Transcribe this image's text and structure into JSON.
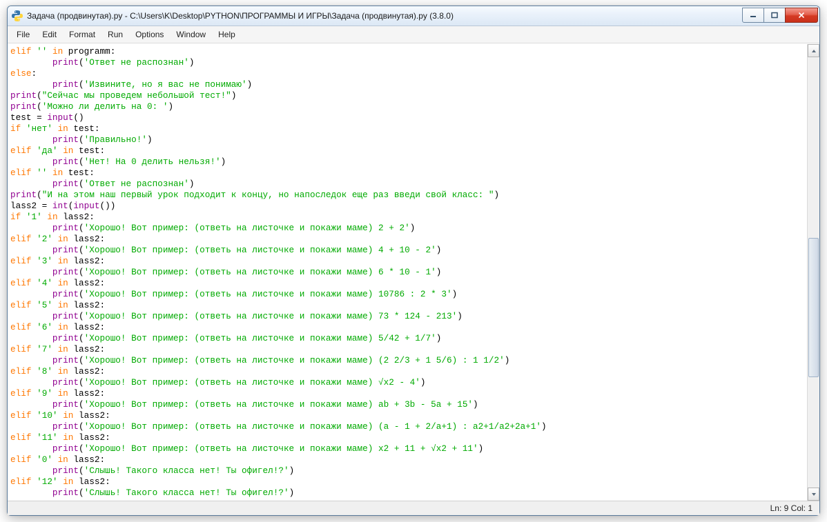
{
  "window": {
    "title": "Задача (продвинутая).py - C:\\Users\\K\\Desktop\\PYTHON\\ПРОГРАММЫ И ИГРЫ\\Задача (продвинутая).py (3.8.0)"
  },
  "menu": [
    "File",
    "Edit",
    "Format",
    "Run",
    "Options",
    "Window",
    "Help"
  ],
  "status": {
    "text": "Ln: 9  Col: 1"
  },
  "code_lines": [
    [
      [
        "kw",
        "elif"
      ],
      [
        "op",
        " "
      ],
      [
        "str",
        "''"
      ],
      [
        "op",
        " "
      ],
      [
        "kw",
        "in"
      ],
      [
        "op",
        " programm:"
      ]
    ],
    [
      [
        "op",
        "        "
      ],
      [
        "bi",
        "print"
      ],
      [
        "op",
        "("
      ],
      [
        "str",
        "'Ответ не распознан'"
      ],
      [
        "op",
        ")"
      ]
    ],
    [
      [
        "kw",
        "else"
      ],
      [
        "op",
        ":"
      ]
    ],
    [
      [
        "op",
        "        "
      ],
      [
        "bi",
        "print"
      ],
      [
        "op",
        "("
      ],
      [
        "str",
        "'Извините, но я вас не понимаю'"
      ],
      [
        "op",
        ")"
      ]
    ],
    [
      [
        "bi",
        "print"
      ],
      [
        "op",
        "("
      ],
      [
        "str",
        "\"Сейчас мы проведем небольшой тест!\""
      ],
      [
        "op",
        ")"
      ]
    ],
    [
      [
        "bi",
        "print"
      ],
      [
        "op",
        "("
      ],
      [
        "str",
        "'Можно ли делить на 0: '"
      ],
      [
        "op",
        ")"
      ]
    ],
    [
      [
        "op",
        "test = "
      ],
      [
        "bi",
        "input"
      ],
      [
        "op",
        "()"
      ]
    ],
    [
      [
        "kw",
        "if"
      ],
      [
        "op",
        " "
      ],
      [
        "str",
        "'нет'"
      ],
      [
        "op",
        " "
      ],
      [
        "kw",
        "in"
      ],
      [
        "op",
        " test:"
      ]
    ],
    [
      [
        "op",
        "        "
      ],
      [
        "bi",
        "print"
      ],
      [
        "op",
        "("
      ],
      [
        "str",
        "'Правильно!'"
      ],
      [
        "op",
        ")"
      ]
    ],
    [
      [
        "kw",
        "elif"
      ],
      [
        "op",
        " "
      ],
      [
        "str",
        "'да'"
      ],
      [
        "op",
        " "
      ],
      [
        "kw",
        "in"
      ],
      [
        "op",
        " test:"
      ]
    ],
    [
      [
        "op",
        "        "
      ],
      [
        "bi",
        "print"
      ],
      [
        "op",
        "("
      ],
      [
        "str",
        "'Нет! На 0 делить нельзя!'"
      ],
      [
        "op",
        ")"
      ]
    ],
    [
      [
        "kw",
        "elif"
      ],
      [
        "op",
        " "
      ],
      [
        "str",
        "''"
      ],
      [
        "op",
        " "
      ],
      [
        "kw",
        "in"
      ],
      [
        "op",
        " test:"
      ]
    ],
    [
      [
        "op",
        "        "
      ],
      [
        "bi",
        "print"
      ],
      [
        "op",
        "("
      ],
      [
        "str",
        "'Ответ не распознан'"
      ],
      [
        "op",
        ")"
      ]
    ],
    [
      [
        "bi",
        "print"
      ],
      [
        "op",
        "("
      ],
      [
        "str",
        "\"И на этом наш первый урок подходит к концу, но напоследок еще раз введи свой класс: \""
      ],
      [
        "op",
        ")"
      ]
    ],
    [
      [
        "op",
        "lass2 = "
      ],
      [
        "bi",
        "int"
      ],
      [
        "op",
        "("
      ],
      [
        "bi",
        "input"
      ],
      [
        "op",
        "())"
      ]
    ],
    [
      [
        "kw",
        "if"
      ],
      [
        "op",
        " "
      ],
      [
        "str",
        "'1'"
      ],
      [
        "op",
        " "
      ],
      [
        "kw",
        "in"
      ],
      [
        "op",
        " lass2:"
      ]
    ],
    [
      [
        "op",
        "        "
      ],
      [
        "bi",
        "print"
      ],
      [
        "op",
        "("
      ],
      [
        "str",
        "'Хорошо! Вот пример: (ответь на листочке и покажи маме) 2 + 2'"
      ],
      [
        "op",
        ")"
      ]
    ],
    [
      [
        "kw",
        "elif"
      ],
      [
        "op",
        " "
      ],
      [
        "str",
        "'2'"
      ],
      [
        "op",
        " "
      ],
      [
        "kw",
        "in"
      ],
      [
        "op",
        " lass2:"
      ]
    ],
    [
      [
        "op",
        "        "
      ],
      [
        "bi",
        "print"
      ],
      [
        "op",
        "("
      ],
      [
        "str",
        "'Хорошо! Вот пример: (ответь на листочке и покажи маме) 4 + 10 - 2'"
      ],
      [
        "op",
        ")"
      ]
    ],
    [
      [
        "kw",
        "elif"
      ],
      [
        "op",
        " "
      ],
      [
        "str",
        "'3'"
      ],
      [
        "op",
        " "
      ],
      [
        "kw",
        "in"
      ],
      [
        "op",
        " lass2:"
      ]
    ],
    [
      [
        "op",
        "        "
      ],
      [
        "bi",
        "print"
      ],
      [
        "op",
        "("
      ],
      [
        "str",
        "'Хорошо! Вот пример: (ответь на листочке и покажи маме) 6 * 10 - 1'"
      ],
      [
        "op",
        ")"
      ]
    ],
    [
      [
        "kw",
        "elif"
      ],
      [
        "op",
        " "
      ],
      [
        "str",
        "'4'"
      ],
      [
        "op",
        " "
      ],
      [
        "kw",
        "in"
      ],
      [
        "op",
        " lass2:"
      ]
    ],
    [
      [
        "op",
        "        "
      ],
      [
        "bi",
        "print"
      ],
      [
        "op",
        "("
      ],
      [
        "str",
        "'Хорошо! Вот пример: (ответь на листочке и покажи маме) 10786 : 2 * 3'"
      ],
      [
        "op",
        ")"
      ]
    ],
    [
      [
        "kw",
        "elif"
      ],
      [
        "op",
        " "
      ],
      [
        "str",
        "'5'"
      ],
      [
        "op",
        " "
      ],
      [
        "kw",
        "in"
      ],
      [
        "op",
        " lass2:"
      ]
    ],
    [
      [
        "op",
        "        "
      ],
      [
        "bi",
        "print"
      ],
      [
        "op",
        "("
      ],
      [
        "str",
        "'Хорошо! Вот пример: (ответь на листочке и покажи маме) 73 * 124 - 213'"
      ],
      [
        "op",
        ")"
      ]
    ],
    [
      [
        "kw",
        "elif"
      ],
      [
        "op",
        " "
      ],
      [
        "str",
        "'6'"
      ],
      [
        "op",
        " "
      ],
      [
        "kw",
        "in"
      ],
      [
        "op",
        " lass2:"
      ]
    ],
    [
      [
        "op",
        "        "
      ],
      [
        "bi",
        "print"
      ],
      [
        "op",
        "("
      ],
      [
        "str",
        "'Хорошо! Вот пример: (ответь на листочке и покажи маме) 5/42 + 1/7'"
      ],
      [
        "op",
        ")"
      ]
    ],
    [
      [
        "kw",
        "elif"
      ],
      [
        "op",
        " "
      ],
      [
        "str",
        "'7'"
      ],
      [
        "op",
        " "
      ],
      [
        "kw",
        "in"
      ],
      [
        "op",
        " lass2:"
      ]
    ],
    [
      [
        "op",
        "        "
      ],
      [
        "bi",
        "print"
      ],
      [
        "op",
        "("
      ],
      [
        "str",
        "'Хорошо! Вот пример: (ответь на листочке и покажи маме) (2 2/3 + 1 5/6) : 1 1/2'"
      ],
      [
        "op",
        ")"
      ]
    ],
    [
      [
        "kw",
        "elif"
      ],
      [
        "op",
        " "
      ],
      [
        "str",
        "'8'"
      ],
      [
        "op",
        " "
      ],
      [
        "kw",
        "in"
      ],
      [
        "op",
        " lass2:"
      ]
    ],
    [
      [
        "op",
        "        "
      ],
      [
        "bi",
        "print"
      ],
      [
        "op",
        "("
      ],
      [
        "str",
        "'Хорошо! Вот пример: (ответь на листочке и покажи маме) √x2 - 4'"
      ],
      [
        "op",
        ")"
      ]
    ],
    [
      [
        "kw",
        "elif"
      ],
      [
        "op",
        " "
      ],
      [
        "str",
        "'9'"
      ],
      [
        "op",
        " "
      ],
      [
        "kw",
        "in"
      ],
      [
        "op",
        " lass2:"
      ]
    ],
    [
      [
        "op",
        "        "
      ],
      [
        "bi",
        "print"
      ],
      [
        "op",
        "("
      ],
      [
        "str",
        "'Хорошо! Вот пример: (ответь на листочке и покажи маме) ab + 3b - 5a + 15'"
      ],
      [
        "op",
        ")"
      ]
    ],
    [
      [
        "kw",
        "elif"
      ],
      [
        "op",
        " "
      ],
      [
        "str",
        "'10'"
      ],
      [
        "op",
        " "
      ],
      [
        "kw",
        "in"
      ],
      [
        "op",
        " lass2:"
      ]
    ],
    [
      [
        "op",
        "        "
      ],
      [
        "bi",
        "print"
      ],
      [
        "op",
        "("
      ],
      [
        "str",
        "'Хорошо! Вот пример: (ответь на листочке и покажи маме) (a - 1 + 2/a+1) : a2+1/a2+2a+1'"
      ],
      [
        "op",
        ")"
      ]
    ],
    [
      [
        "kw",
        "elif"
      ],
      [
        "op",
        " "
      ],
      [
        "str",
        "'11'"
      ],
      [
        "op",
        " "
      ],
      [
        "kw",
        "in"
      ],
      [
        "op",
        " lass2:"
      ]
    ],
    [
      [
        "op",
        "        "
      ],
      [
        "bi",
        "print"
      ],
      [
        "op",
        "("
      ],
      [
        "str",
        "'Хорошо! Вот пример: (ответь на листочке и покажи маме) x2 + 11 + √x2 + 11'"
      ],
      [
        "op",
        ")"
      ]
    ],
    [
      [
        "kw",
        "elif"
      ],
      [
        "op",
        " "
      ],
      [
        "str",
        "'0'"
      ],
      [
        "op",
        " "
      ],
      [
        "kw",
        "in"
      ],
      [
        "op",
        " lass2:"
      ]
    ],
    [
      [
        "op",
        "        "
      ],
      [
        "bi",
        "print"
      ],
      [
        "op",
        "("
      ],
      [
        "str",
        "'Слышь! Такого класса нет! Ты офигел!?'"
      ],
      [
        "op",
        ")"
      ]
    ],
    [
      [
        "kw",
        "elif"
      ],
      [
        "op",
        " "
      ],
      [
        "str",
        "'12'"
      ],
      [
        "op",
        " "
      ],
      [
        "kw",
        "in"
      ],
      [
        "op",
        " lass2:"
      ]
    ],
    [
      [
        "op",
        "        "
      ],
      [
        "bi",
        "print"
      ],
      [
        "op",
        "("
      ],
      [
        "str",
        "'Слышь! Такого класса нет! Ты офигел!?'"
      ],
      [
        "op",
        ")"
      ]
    ]
  ]
}
